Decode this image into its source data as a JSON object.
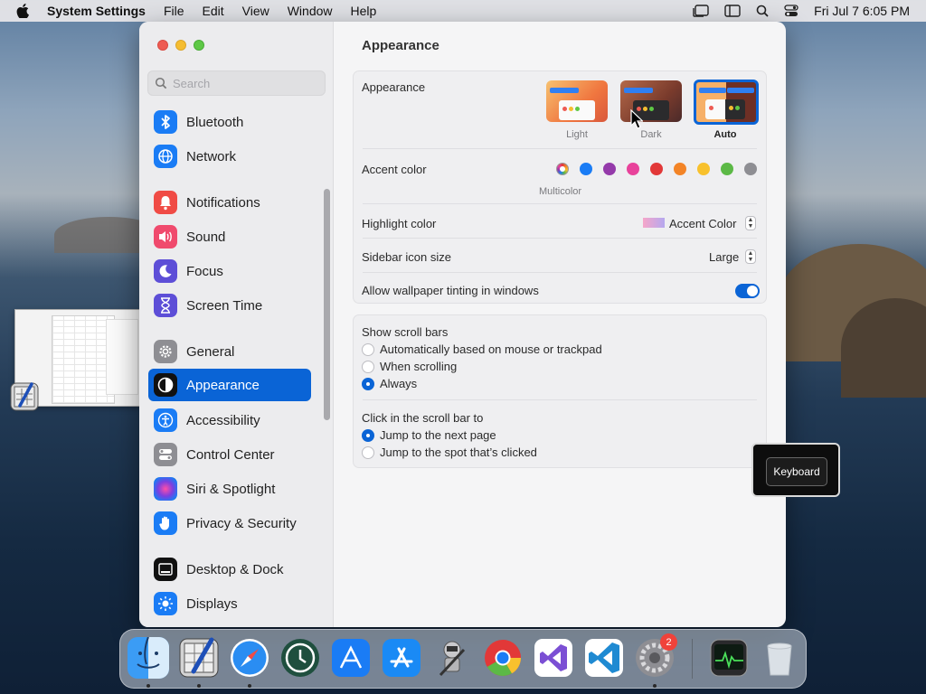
{
  "menubar": {
    "app_name": "System Settings",
    "menus": [
      "File",
      "Edit",
      "View",
      "Window",
      "Help"
    ],
    "clock": "Fri Jul 7  6:05 PM"
  },
  "window": {
    "search_placeholder": "Search",
    "sidebar_items": [
      {
        "label": "Bluetooth",
        "icon": "bluetooth-icon",
        "color": "#1a7cf5"
      },
      {
        "label": "Network",
        "icon": "globe-icon",
        "color": "#1a7cf5"
      },
      {
        "label": "Notifications",
        "icon": "bell-icon",
        "color": "#f04b45"
      },
      {
        "label": "Sound",
        "icon": "speaker-icon",
        "color": "#f04a6d"
      },
      {
        "label": "Focus",
        "icon": "moon-icon",
        "color": "#5d4ed7"
      },
      {
        "label": "Screen Time",
        "icon": "hourglass-icon",
        "color": "#5d4ed7"
      },
      {
        "label": "General",
        "icon": "gear-icon",
        "color": "#8e8e93"
      },
      {
        "label": "Appearance",
        "icon": "appearance-icon",
        "color": "#111111",
        "selected": true
      },
      {
        "label": "Accessibility",
        "icon": "accessibility-icon",
        "color": "#1a7cf5"
      },
      {
        "label": "Control Center",
        "icon": "toggles-icon",
        "color": "#8e8e93"
      },
      {
        "label": "Siri & Spotlight",
        "icon": "siri-icon",
        "color": "#b445d8"
      },
      {
        "label": "Privacy & Security",
        "icon": "hand-icon",
        "color": "#1a7cf5"
      },
      {
        "label": "Desktop & Dock",
        "icon": "dock-icon",
        "color": "#111111"
      },
      {
        "label": "Displays",
        "icon": "sun-icon",
        "color": "#1a7cf5"
      }
    ],
    "page_title": "Appearance",
    "appearance": {
      "label": "Appearance",
      "options": [
        "Light",
        "Dark",
        "Auto"
      ],
      "selected": "Auto"
    },
    "accent": {
      "label": "Accent color",
      "caption": "Multicolor",
      "colors": [
        "#1a7cf5",
        "#943aaa",
        "#e8429b",
        "#e23838",
        "#f38427",
        "#f8c12d",
        "#5cb946",
        "#8e8e93"
      ]
    },
    "highlight": {
      "label": "Highlight color",
      "value": "Accent Color"
    },
    "icon_size": {
      "label": "Sidebar icon size",
      "value": "Large"
    },
    "tinting": {
      "label": "Allow wallpaper tinting in windows",
      "on": true
    },
    "scroll_bars": {
      "label": "Show scroll bars",
      "options": [
        "Automatically based on mouse or trackpad",
        "When scrolling",
        "Always"
      ],
      "selected": "Always"
    },
    "scroll_click": {
      "label": "Click in the scroll bar to",
      "options": [
        "Jump to the next page",
        "Jump to the spot that’s clicked"
      ],
      "selected": "Jump to the next page"
    }
  },
  "tooltip": {
    "label": "Keyboard"
  },
  "dock": {
    "apps": [
      "Finder",
      "Script Editor",
      "Safari",
      "Time Machine",
      "Xcode Instruments",
      "App Store",
      "Automator",
      "Chrome",
      "Visual Studio",
      "VS Code",
      "System Settings",
      "Activity Monitor",
      "Trash"
    ],
    "settings_badge": "2"
  }
}
